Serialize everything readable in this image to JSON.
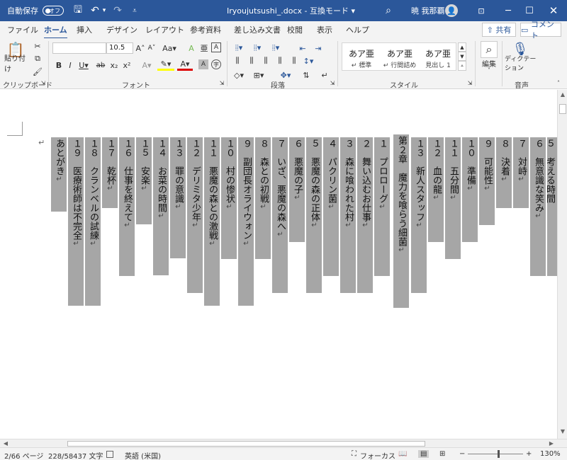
{
  "titlebar": {
    "autosave_label": "自動保存",
    "autosave_state": "オフ",
    "doc_title": "Iryoujutsushi_.docx  -  互換モード  ▾",
    "user_name": "暁 我那覇",
    "avatar_glyph": "👤"
  },
  "tabs": [
    "ファイル",
    "ホーム",
    "挿入",
    "デザイン",
    "レイアウト",
    "参考資料",
    "差し込み文書",
    "校閲",
    "表示",
    "ヘルプ"
  ],
  "active_tab": "ホーム",
  "share_label": "共有",
  "comment_label": "コメント",
  "ribbon": {
    "clipboard": {
      "paste_label": "貼り付け",
      "group_label": "クリップボード"
    },
    "font": {
      "font_name": "",
      "font_size": "10.5",
      "group_label": "フォント"
    },
    "paragraph": {
      "group_label": "段落"
    },
    "styles": {
      "group_label": "スタイル",
      "items": [
        {
          "sample": "あア亜",
          "name": "↵ 標準"
        },
        {
          "sample": "あア亜",
          "name": "↵ 行間詰め"
        },
        {
          "sample": "あア亜",
          "name": "見出し 1"
        }
      ]
    },
    "editing": {
      "label": "編集"
    },
    "voice": {
      "dictate_label": "ディクテーション",
      "group_label": "音声"
    }
  },
  "document": {
    "columns": [
      "あとがき",
      "１９　医療術師は不完全",
      "１８　クランベルの試練",
      "１７　乾杯",
      "１６　仕事を終えて",
      "１５　安楽",
      "１４　お菜の時間",
      "１３　罪の意識",
      "１２　デリミタ少年",
      "１１　悪魔の森との激戦",
      "１０　村の惨状",
      "９　副団長オライウォン",
      "８　森との初戦",
      "７　いざ、悪魔の森へ",
      "６　悪魔の子",
      "５　悪魔の森の正体",
      "４　パクリン菌",
      "３　森に喰われた村",
      "２　舞い込むお仕事",
      "１　プロローグ",
      "第２章　魔力を喰らう細菌",
      "１３　新人スタッフ",
      "１２　血の龍",
      "１１　五分間",
      "１０　準備",
      "９　可能性",
      "８　決着",
      "７　対峙",
      "６　無意識な笑み",
      "５　考える時間"
    ],
    "para_mark": "↵"
  },
  "statusbar": {
    "page": "2/66 ページ",
    "words": "228/58437 文字",
    "language": "英語 (米国)",
    "focus": "フォーカス",
    "zoom": "130%"
  }
}
